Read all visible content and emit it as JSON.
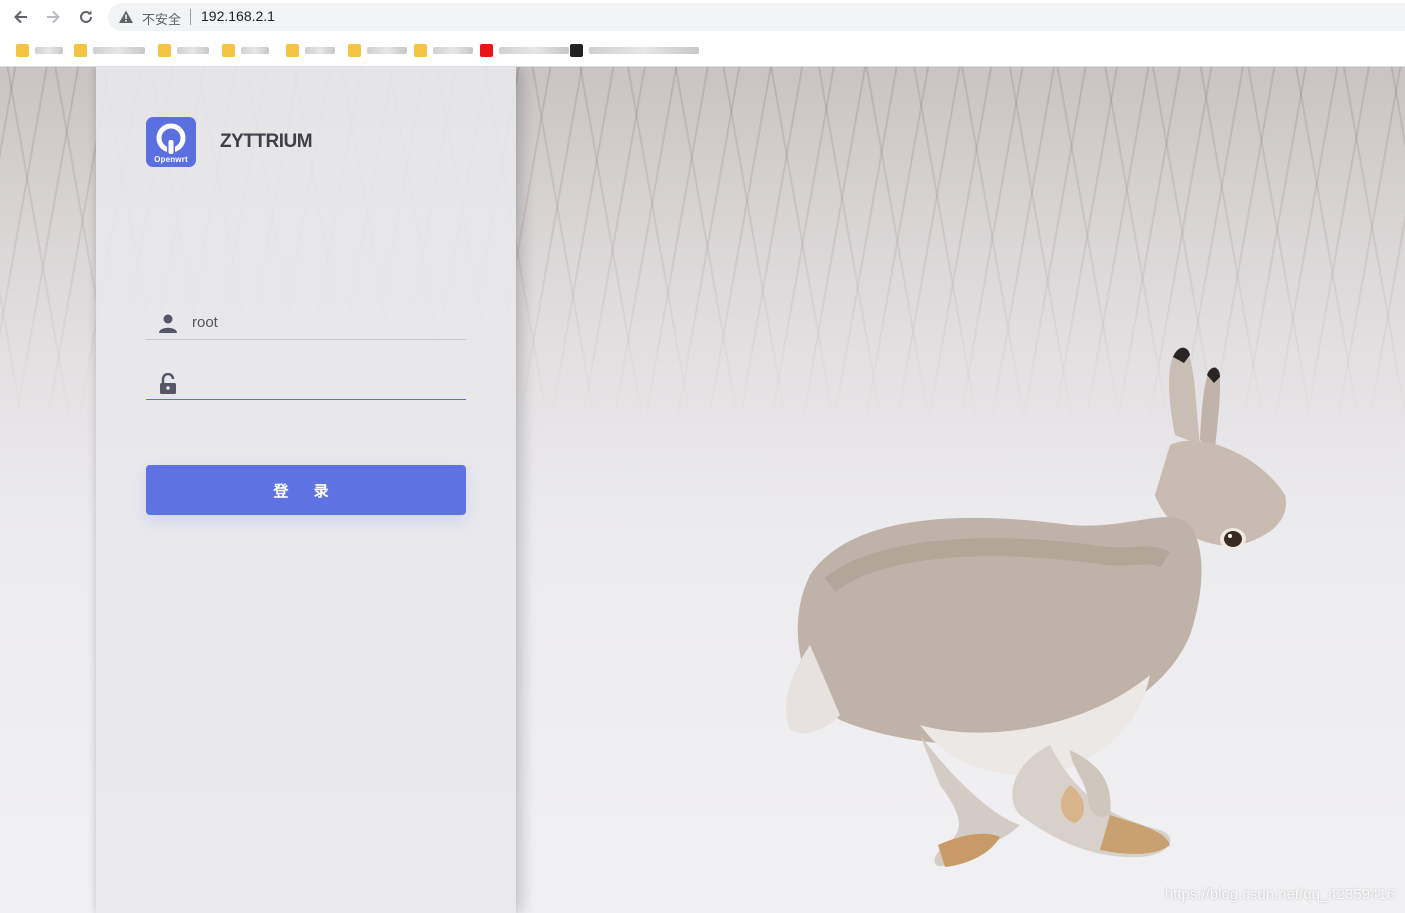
{
  "browser": {
    "security_label": "不安全",
    "url": "192.168.2.1"
  },
  "bookmarks": [
    {
      "icon_color": "#f6c443"
    },
    {
      "icon_color": "#f6c443"
    },
    {
      "icon_color": "#f6c443"
    },
    {
      "icon_color": "#f6c443"
    },
    {
      "icon_color": "#f6c443"
    },
    {
      "icon_color": "#f6c443"
    },
    {
      "icon_color": "#f6c443"
    },
    {
      "icon_color": "#e8151b"
    },
    {
      "icon_color": "#222222"
    }
  ],
  "login": {
    "logo_text": "Openwrt",
    "brand": "ZYTTRIUM",
    "username_value": "root",
    "password_value": "",
    "submit_label": "登 录",
    "accent_color": "#5f72e2"
  },
  "watermark": "https://blog.csdn.net/qq_42359416"
}
